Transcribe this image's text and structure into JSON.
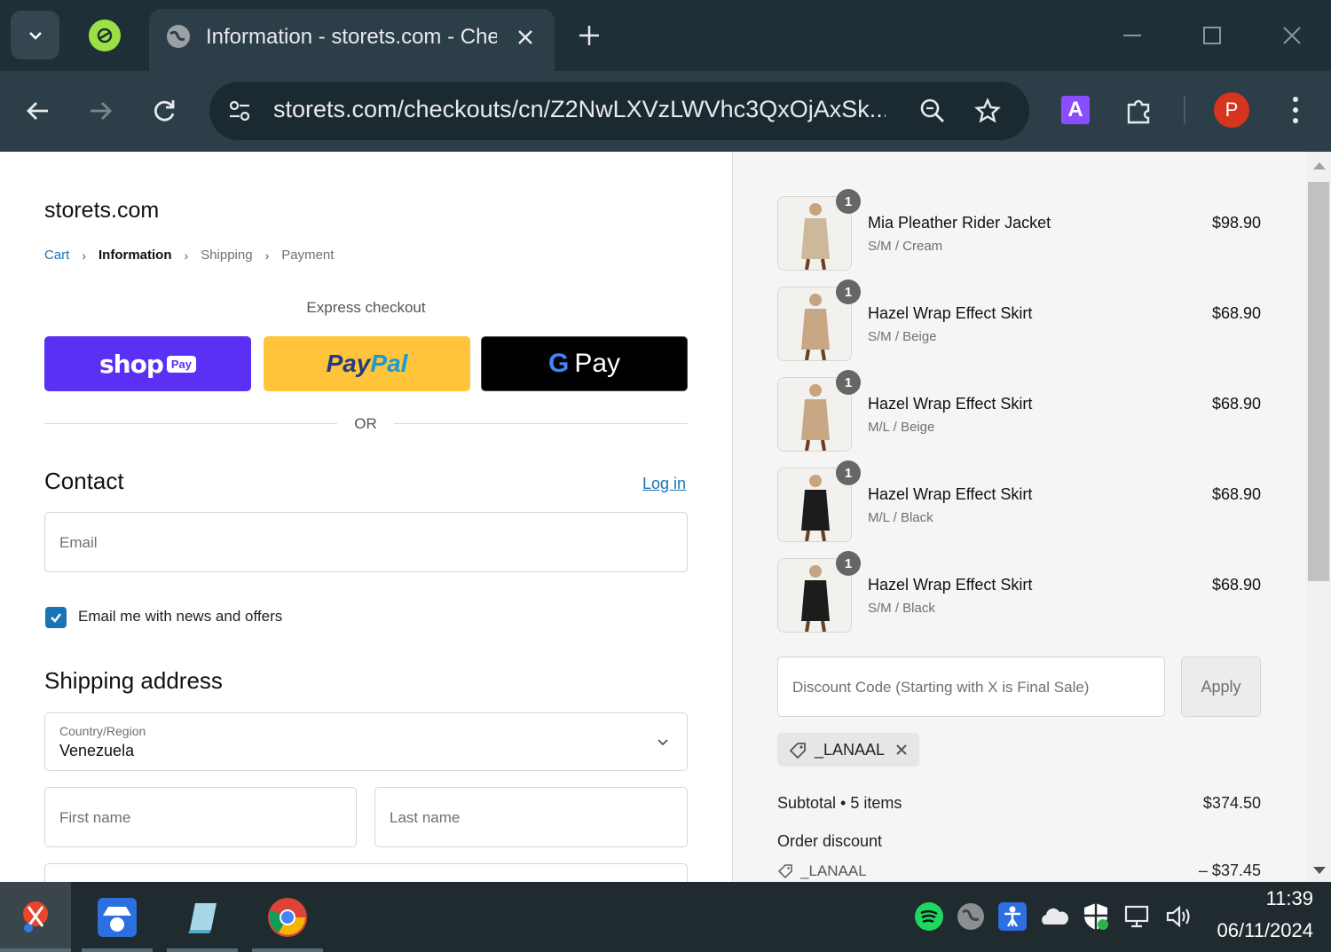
{
  "browser": {
    "tab_title": "Information - storets.com - Checkout",
    "url": "storets.com/checkouts/cn/Z2NwLXVzLWVhc3QxOjAxSk...",
    "profile_initial": "P",
    "extension_label": "A"
  },
  "checkout": {
    "store_name": "storets.com",
    "breadcrumb": {
      "cart": "Cart",
      "information": "Information",
      "shipping": "Shipping",
      "payment": "Payment"
    },
    "express_checkout_label": "Express checkout",
    "shop_pay": {
      "word": "shop",
      "tag": "Pay"
    },
    "paypal": {
      "part1": "Pay",
      "part2": "Pal"
    },
    "gpay": {
      "g": "G",
      "word": "Pay"
    },
    "or_label": "OR",
    "contact_title": "Contact",
    "login_link": "Log in",
    "email_placeholder": "Email",
    "newsletter_label": "Email me with news and offers",
    "newsletter_checked": true,
    "shipping_title": "Shipping address",
    "country_label": "Country/Region",
    "country_value": "Venezuela",
    "first_name_placeholder": "First name",
    "last_name_placeholder": "Last name"
  },
  "summary": {
    "items": [
      {
        "name": "Mia Pleather Rider Jacket",
        "variant": "S/M / Cream",
        "price": "$98.90",
        "qty": "1",
        "color": "#cdb89a"
      },
      {
        "name": "Hazel Wrap Effect Skirt",
        "variant": "S/M / Beige",
        "price": "$68.90",
        "qty": "1",
        "color": "#c8a884"
      },
      {
        "name": "Hazel Wrap Effect Skirt",
        "variant": "M/L / Beige",
        "price": "$68.90",
        "qty": "1",
        "color": "#c8a884"
      },
      {
        "name": "Hazel Wrap Effect Skirt",
        "variant": "M/L / Black",
        "price": "$68.90",
        "qty": "1",
        "color": "#1c1c1c"
      },
      {
        "name": "Hazel Wrap Effect Skirt",
        "variant": "S/M / Black",
        "price": "$68.90",
        "qty": "1",
        "color": "#1c1c1c"
      }
    ],
    "discount_placeholder": "Discount Code (Starting with X is Final Sale)",
    "apply_label": "Apply",
    "applied_code": "_LANAAL",
    "subtotal_label": "Subtotal • 5 items",
    "subtotal_value": "$374.50",
    "order_discount_label": "Order discount",
    "order_discount_code": "_LANAAL",
    "order_discount_value": "– $37.45"
  },
  "taskbar": {
    "time": "11:39",
    "date": "06/11/2024"
  },
  "colors": {
    "shop_pay": "#5a31f4",
    "paypal": "#ffc439",
    "link": "#1a73b5",
    "chrome_dark": "#1f2f37"
  }
}
